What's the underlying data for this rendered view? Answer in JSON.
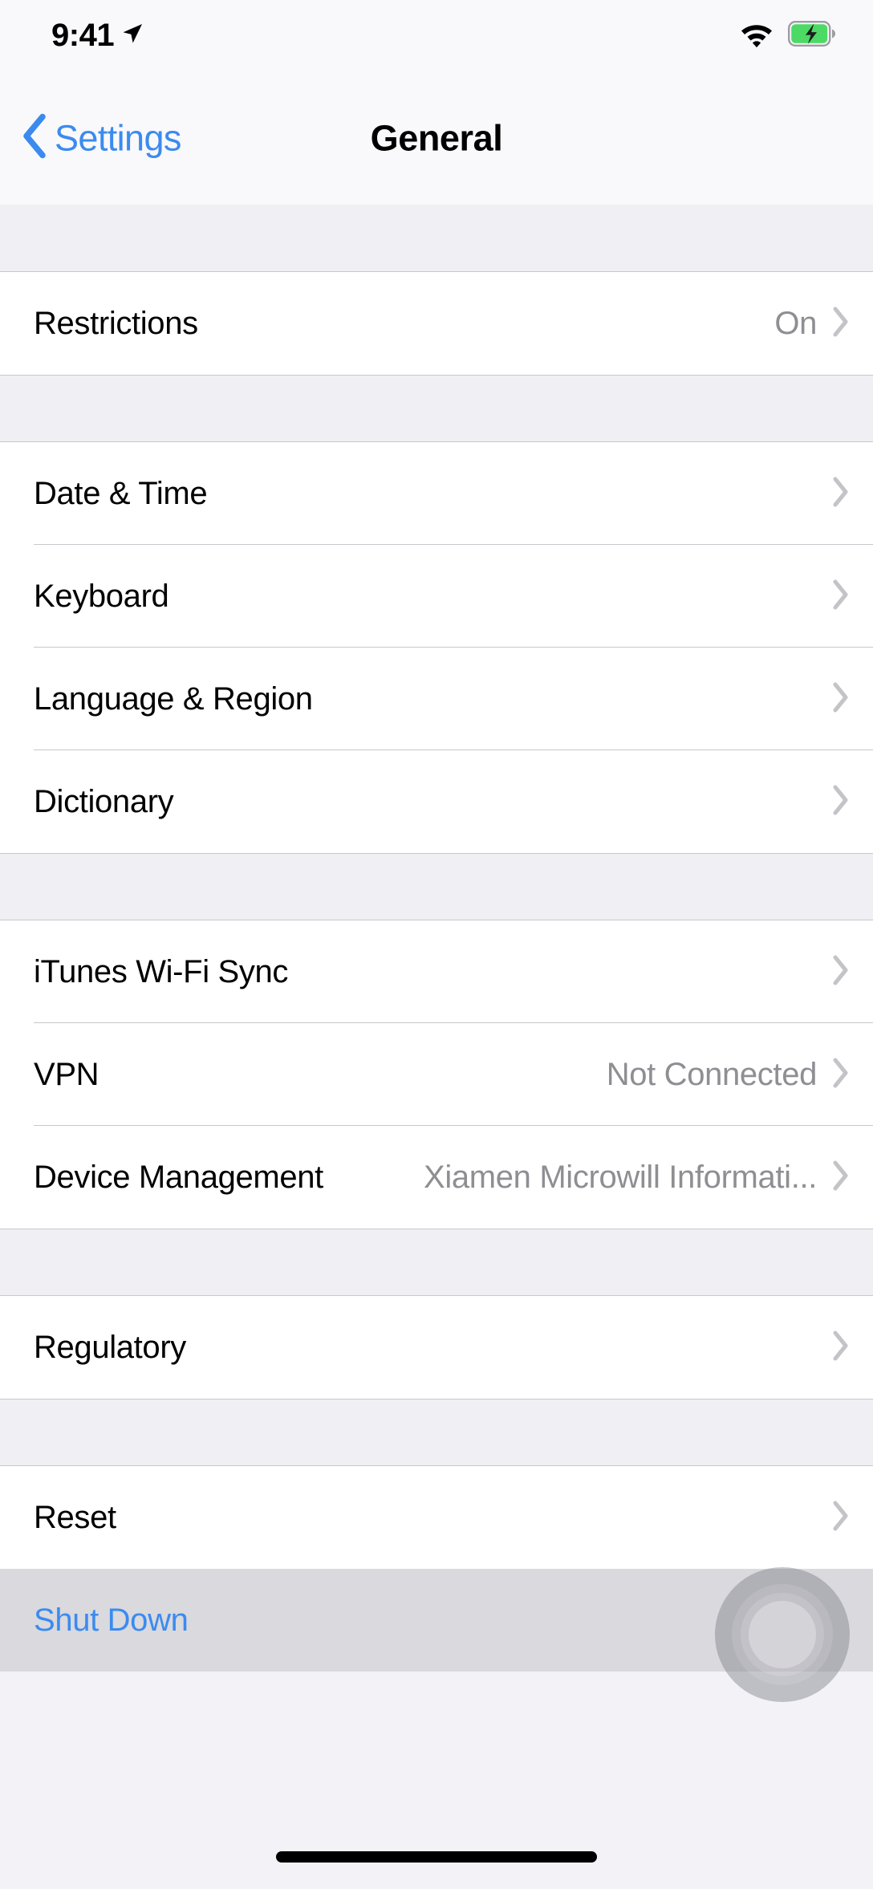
{
  "status_bar": {
    "time": "9:41",
    "location_icon": "location-arrow-icon",
    "wifi_icon": "wifi-icon",
    "battery_icon": "battery-charging-icon",
    "battery_color": "#4CD964"
  },
  "nav_bar": {
    "back_label": "Settings",
    "back_icon": "chevron-left-icon",
    "title": "General",
    "accent_color": "#3B8BEF"
  },
  "sections": [
    {
      "id": "restrictions-section",
      "rows": [
        {
          "label": "Restrictions",
          "value": "On",
          "chevron": true,
          "pressed": false
        }
      ]
    },
    {
      "id": "localization-section",
      "rows": [
        {
          "label": "Date & Time",
          "value": "",
          "chevron": true,
          "pressed": false
        },
        {
          "label": "Keyboard",
          "value": "",
          "chevron": true,
          "pressed": false
        },
        {
          "label": "Language & Region",
          "value": "",
          "chevron": true,
          "pressed": false
        },
        {
          "label": "Dictionary",
          "value": "",
          "chevron": true,
          "pressed": false
        }
      ]
    },
    {
      "id": "connectivity-section",
      "rows": [
        {
          "label": "iTunes Wi-Fi Sync",
          "value": "",
          "chevron": true,
          "pressed": false
        },
        {
          "label": "VPN",
          "value": "Not Connected",
          "chevron": true,
          "pressed": false
        },
        {
          "label": "Device Management",
          "value": "Xiamen Microwill Informati...",
          "chevron": true,
          "pressed": false
        }
      ]
    },
    {
      "id": "regulatory-section",
      "rows": [
        {
          "label": "Regulatory",
          "value": "",
          "chevron": true,
          "pressed": false
        }
      ]
    },
    {
      "id": "reset-section",
      "rows": [
        {
          "label": "Reset",
          "value": "",
          "chevron": true,
          "pressed": false
        },
        {
          "label": "Shut Down",
          "value": "",
          "chevron": false,
          "pressed": true,
          "accent": true
        }
      ]
    }
  ],
  "assistive_touch": {
    "icon": "assistive-touch-icon"
  },
  "home_indicator": {
    "icon": "home-indicator-bar"
  },
  "colors": {
    "accent_blue": "#3B8BEF",
    "row_background": "#FFFFFF",
    "group_gap": "#EFEFF4",
    "separator": "#C8C7CC",
    "pressed_row": "#D9D9DE",
    "secondary_text": "#8E8E93",
    "page_background": "#F2F2F7"
  }
}
